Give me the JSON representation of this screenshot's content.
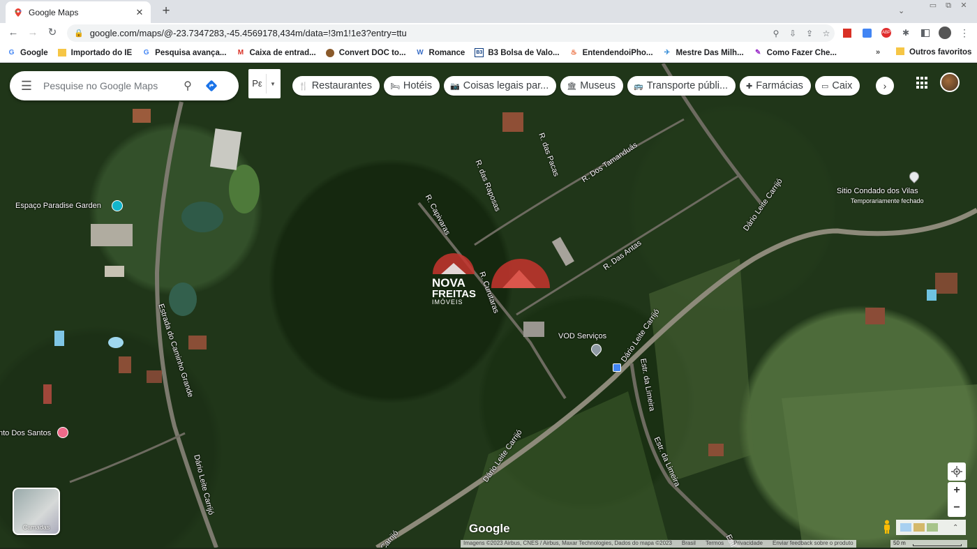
{
  "browser": {
    "tab_title": "Google Maps",
    "tab_close": "✕",
    "new_tab": "+",
    "tab_search": "⌄",
    "window_controls": [
      "▭",
      "⧉",
      "✕"
    ],
    "url": "google.com/maps/@-23.7347283,-45.4569178,434m/data=!3m1!1e3?entry=ttu",
    "bookmarks": [
      {
        "label": "Google",
        "icon": "google-g"
      },
      {
        "label": "Importado do IE",
        "icon": "folder"
      },
      {
        "label": "Pesquisa avança...",
        "icon": "google-g"
      },
      {
        "label": "Caixa de entrad...",
        "icon": "gmail"
      },
      {
        "label": "Convert DOC to...",
        "icon": "convert"
      },
      {
        "label": "Romance",
        "icon": "wordpress"
      },
      {
        "label": "B3 Bolsa de Valo...",
        "icon": "b3"
      },
      {
        "label": "EntendendoiPho...",
        "icon": "fire"
      },
      {
        "label": "Mestre Das Milh...",
        "icon": "plane"
      },
      {
        "label": "Como Fazer Che...",
        "icon": "feather"
      }
    ],
    "bookmarks_more": "»",
    "other_favorites": "Outros favoritos"
  },
  "maps": {
    "search_placeholder": "Pesquise no Google Maps",
    "peg_select": "Pε",
    "chips": [
      {
        "label": "Restaurantes",
        "icon": "🍴"
      },
      {
        "label": "Hotéis",
        "icon": "🛏"
      },
      {
        "label": "Coisas legais par...",
        "icon": "📷"
      },
      {
        "label": "Museus",
        "icon": "🏛"
      },
      {
        "label": "Transporte públi...",
        "icon": "🚌"
      },
      {
        "label": "Farmácias",
        "icon": "✚"
      },
      {
        "label": "Caix",
        "icon": "▭"
      }
    ],
    "chips_next": "›",
    "layers_label": "Camadas",
    "google_logo": "Google",
    "attribution": [
      "Imagens ©2023 Airbus, CNES / Airbus, Maxar Technologies, Dados do mapa ©2023",
      "Brasil",
      "Termos",
      "Privacidade",
      "Enviar feedback sobre o produto"
    ],
    "scale": "50 m",
    "zoom_in": "+",
    "zoom_out": "−",
    "roads": [
      "R. das Pacas",
      "R. Dos Tamanduás",
      "R. das Raposas",
      "R. Capivaras",
      "R. Das Antas",
      "R. Curutaras",
      "Dário Leite Carrijó",
      "Dário Leite Carrijó",
      "Dário Leite Carrijó",
      "Estrada do Caminho Grande",
      "Dário Leite Carrijó",
      "Estr. da Limeira",
      "Estr. da Limeira",
      "Carrijó",
      "Estr"
    ],
    "pois": {
      "paradise": "Espaço Paradise Garden",
      "sitio": "Sitio Condado dos Vilas",
      "sitio_sub": "Temporariamente fechado",
      "vod": "VOD Serviços",
      "santos": "nto Dos Santos"
    },
    "watermark": {
      "line1": "NOVA",
      "line2": "FREITAS",
      "line3": "IMÓVEIS"
    }
  }
}
